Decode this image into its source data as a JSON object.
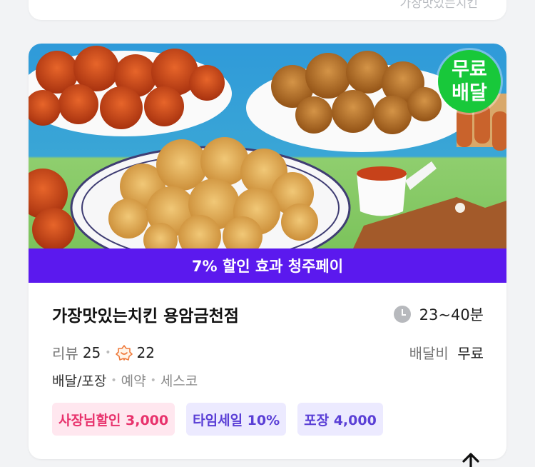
{
  "previous_card": {
    "brand": "가장맛있는치킨"
  },
  "store": {
    "promo_banner": "7% 할인 효과 청주페이",
    "badge": {
      "line1": "무료",
      "line2": "배달"
    },
    "name": "가장맛있는치킨 용암금천점",
    "delivery_time": "23~40분",
    "review_label": "리뷰",
    "review_count": "25",
    "rating_count": "22",
    "delivery_fee_label": "배달비",
    "delivery_fee_value": "무료",
    "service_main": "배달/포장",
    "service_extra1": "예약",
    "service_extra2": "세스코",
    "coupons": [
      {
        "label": "사장님할인 3,000"
      },
      {
        "label": "타임세일 10%"
      },
      {
        "label": "포장 4,000"
      }
    ]
  },
  "colors": {
    "promo_bg": "#5b19ee",
    "badge_green": "#18c83a",
    "chip_pink_text": "#e8326c",
    "chip_purple_text": "#5a3fd6"
  },
  "icons": {
    "clock": "clock-icon",
    "rating": "flower-badge-icon",
    "scroll_top": "arrow-up-icon"
  }
}
